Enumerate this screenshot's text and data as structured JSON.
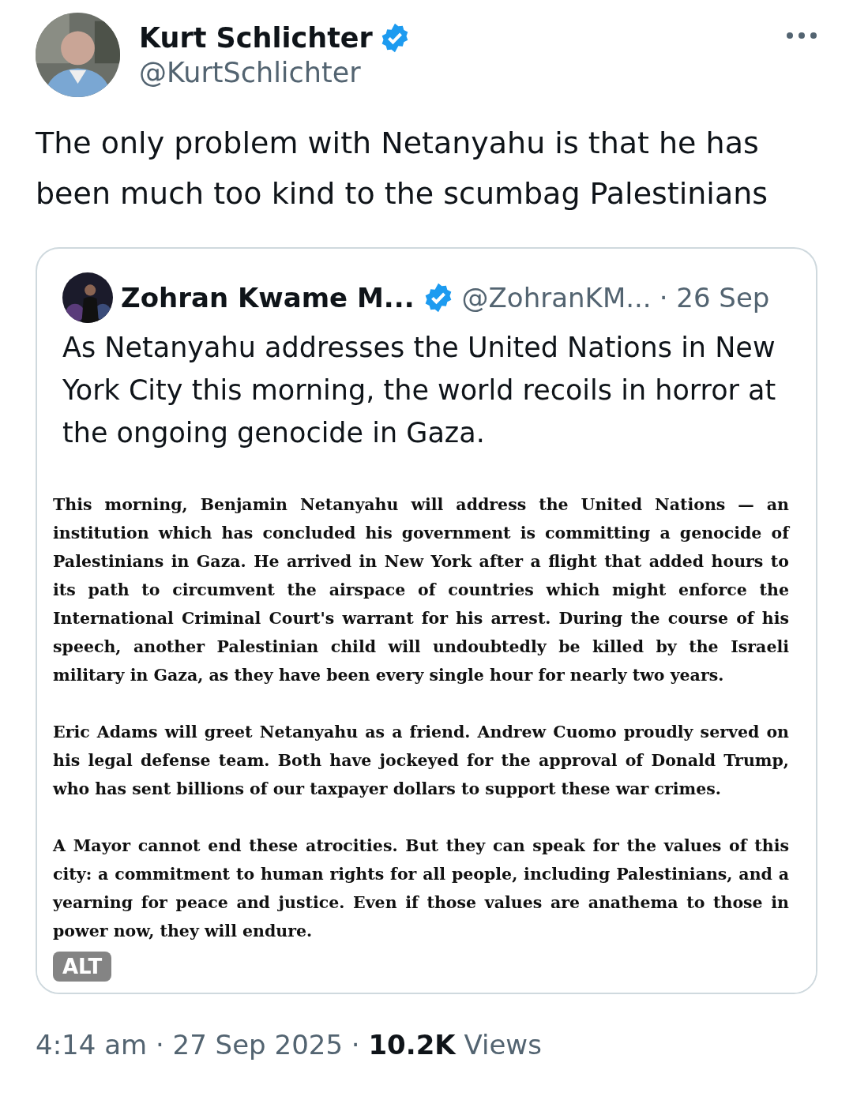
{
  "author": {
    "name": "Kurt Schlichter",
    "verified": true,
    "handle": "@KurtSchlichter"
  },
  "text": "The only problem with Netanyahu is that he has been much too kind to the scumbag Palestinians",
  "quote": {
    "author": {
      "name": "Zohran Kwame M...",
      "verified": true,
      "handle": "@ZohranKM...",
      "date": "· 26 Sep"
    },
    "text": "As Netanyahu addresses the United Nations in New York City this morning, the world recoils in horror at the ongoing genocide in Gaza.",
    "attachment": {
      "paragraphs": [
        "This morning, Benjamin Netanyahu will address the United Nations — an institution which has concluded his government is committing a genocide of Palestinians in Gaza. He arrived in New York after a flight that added hours to its path to circumvent the airspace of countries which might enforce the International Criminal Court's warrant for his arrest. During the course of his speech, another Palestinian child will undoubtedly be killed by the Israeli military in Gaza, as they have been every single hour for nearly two years.",
        "Eric Adams will greet Netanyahu as a friend. Andrew Cuomo proudly served on his legal defense team. Both have jockeyed for the approval of Donald Trump, who has sent billions of our taxpayer dollars to support these war crimes.",
        "A Mayor cannot end these atrocities. But they can speak for the values of this city: a commitment to human rights for all people, including Palestinians, and a yearning for peace and justice. Even if those values are anathema to those in power now, they will endure."
      ],
      "alt_badge": "ALT"
    }
  },
  "footer": "4:14 am · 27 Sep 2025 · **10.2K** Views"
}
